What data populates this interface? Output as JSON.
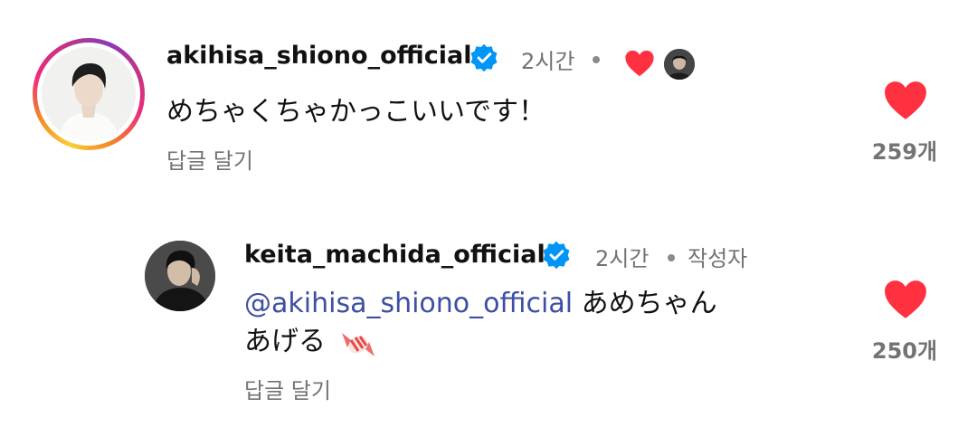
{
  "comments": [
    {
      "username": "akihisa_shiono_official",
      "time": "2시간",
      "text": "めちゃくちゃかっこいいです！",
      "reply_label": "답글 달기",
      "like_count": "259개"
    },
    {
      "username": "keita_machida_official",
      "time": "2시간",
      "author_label": "작성자",
      "mention": "@akihisa_shiono_official",
      "text_line1": " あめちゃん",
      "text_line2": "あげる",
      "reply_label": "답글 달기",
      "like_count": "250개"
    }
  ],
  "colors": {
    "like_red": "#ff3040",
    "verified_blue": "#0095f6",
    "mention": "#3e4fa3",
    "meta_gray": "#737373"
  },
  "icons": [
    "verified-badge-icon",
    "heart-icon",
    "candy-emoji-icon"
  ]
}
